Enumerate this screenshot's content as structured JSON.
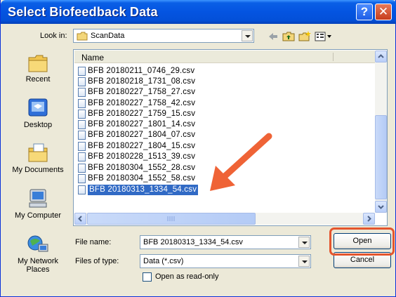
{
  "window": {
    "title": "Select Biofeedback Data",
    "help": "?",
    "close": "✕"
  },
  "look_in": {
    "label": "Look in:",
    "value": "ScanData"
  },
  "places": [
    {
      "label": "Recent",
      "icon": "recent-folder-icon"
    },
    {
      "label": "Desktop",
      "icon": "desktop-icon"
    },
    {
      "label": "My Documents",
      "icon": "my-documents-icon"
    },
    {
      "label": "My Computer",
      "icon": "my-computer-icon"
    },
    {
      "label": "My Network Places",
      "icon": "network-places-icon"
    }
  ],
  "list": {
    "column": "Name",
    "files": [
      "BFB 20180211_0746_29.csv",
      "BFB 20180218_1731_08.csv",
      "BFB 20180227_1758_27.csv",
      "BFB 20180227_1758_42.csv",
      "BFB 20180227_1759_15.csv",
      "BFB 20180227_1801_14.csv",
      "BFB 20180227_1804_07.csv",
      "BFB 20180227_1804_15.csv",
      "BFB 20180228_1513_39.csv",
      "BFB 20180304_1552_28.csv",
      "BFB 20180304_1552_58.csv",
      "BFB 20180313_1334_54.csv"
    ],
    "selected_index": 11
  },
  "file_name": {
    "label": "File name:",
    "value": "BFB 20180313_1334_54.csv"
  },
  "file_type": {
    "label": "Files of type:",
    "value": "Data (*.csv)"
  },
  "readonly": {
    "label": "Open as read-only",
    "checked": false
  },
  "buttons": {
    "open": "Open",
    "cancel": "Cancel"
  },
  "colors": {
    "title_bar": "#0454e1",
    "selection": "#316ac5",
    "highlight_annotation": "#e4552d"
  }
}
